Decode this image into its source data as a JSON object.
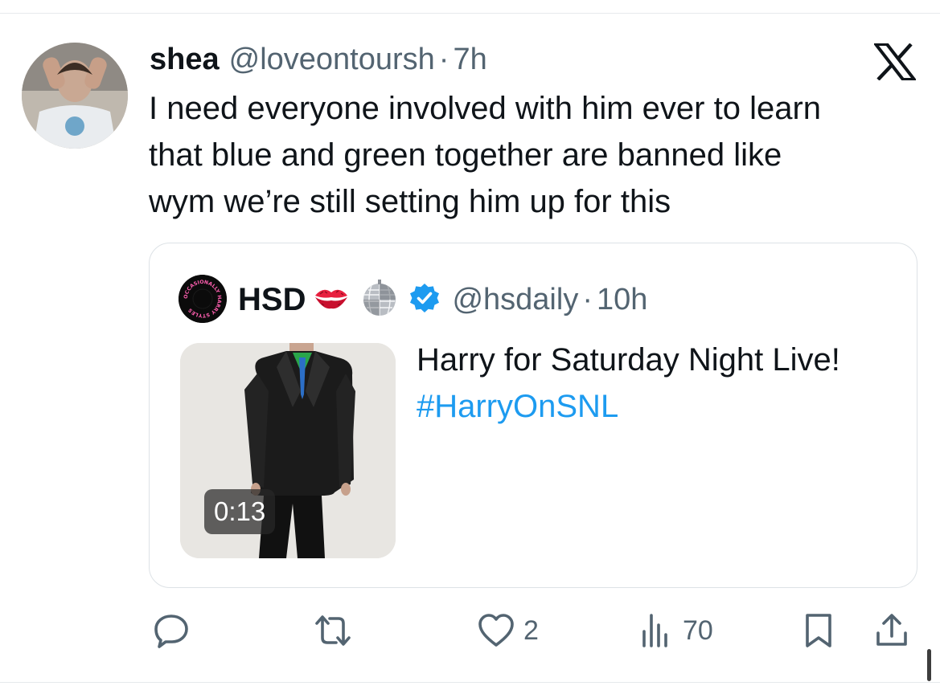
{
  "tweet": {
    "display_name": "shea",
    "handle": "@loveontoursh",
    "separator": "·",
    "time": "7h",
    "text": "I need everyone involved with him ever to learn\nthat blue and green together are banned like\nwym we’re still setting him up for this"
  },
  "quote": {
    "display_name": "HSD",
    "emojis": [
      "kiss-mark-emoji",
      "mirror-ball-emoji"
    ],
    "verified": true,
    "handle": "@hsdaily",
    "separator": "·",
    "time": "10h",
    "text": "Harry for Saturday Night Live!",
    "hashtag": "#HarryOnSNL",
    "avatar_logo_text": "OCCASIONALLY HARRY STYLES",
    "video_duration": "0:13"
  },
  "actions": {
    "reply_count": "",
    "retweet_count": "",
    "like_count": "2",
    "views_count": "70"
  },
  "icons": [
    "x-logo-icon",
    "reply-icon",
    "retweet-icon",
    "heart-icon",
    "views-icon",
    "bookmark-icon",
    "share-icon",
    "verified-badge-icon"
  ],
  "colors": {
    "text": "#0f1419",
    "secondary": "#536471",
    "link": "#1d9bf0",
    "verified": "#1d9bf0",
    "border": "#dde2e6"
  }
}
